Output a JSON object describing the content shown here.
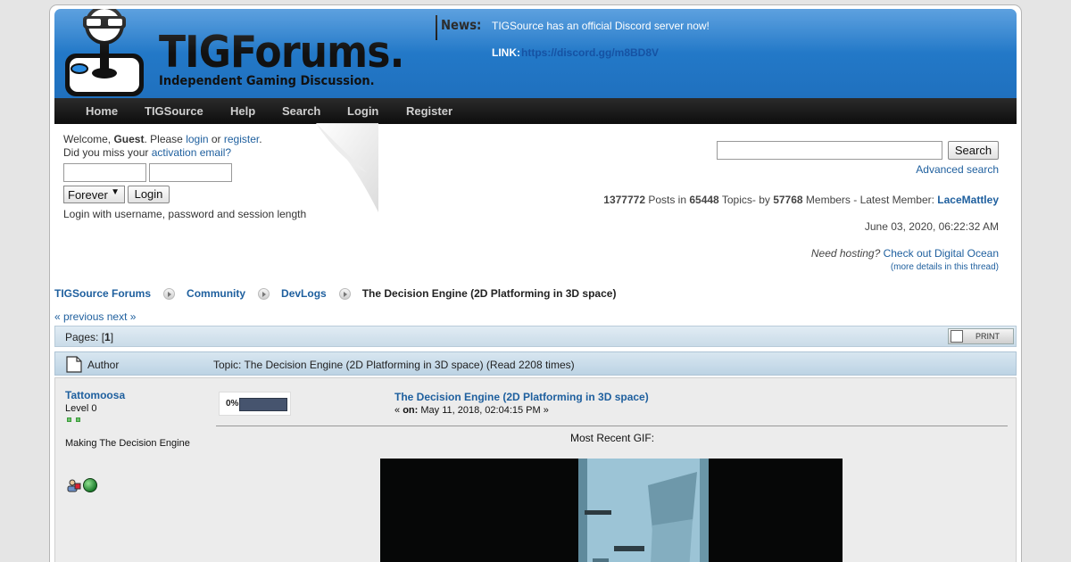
{
  "header": {
    "site_title": "TIGForums.",
    "site_subtitle": "Independent Gaming Discussion.",
    "news_label": "News:",
    "news_text": "TIGSource has an official Discord server now!",
    "news_link_label": "LINK:",
    "news_link": "https://discord.gg/m8BD8V",
    "banner_color": "#2379c8"
  },
  "nav": {
    "items": [
      {
        "label": "Home"
      },
      {
        "label": "TIGSource"
      },
      {
        "label": "Help"
      },
      {
        "label": "Search"
      },
      {
        "label": "Login"
      },
      {
        "label": "Register"
      }
    ]
  },
  "user_panel": {
    "welcome_prefix": "Welcome, ",
    "guest": "Guest",
    "please": ". Please ",
    "login_link": "login",
    "or": " or ",
    "register_link": "register",
    "period": ".",
    "missed_prefix": "Did you miss your ",
    "activation_link": "activation email?",
    "username_value": "",
    "password_value": "",
    "session_length": "Forever",
    "login_button": "Login",
    "login_note": "Login with username, password and session length"
  },
  "search": {
    "query": "",
    "button": "Search",
    "advanced": "Advanced search"
  },
  "stats": {
    "posts": "1377772",
    "posts_label": " Posts in ",
    "topics": "65448",
    "topics_label": " Topics- by ",
    "members": "57768",
    "members_label": " Members - Latest Member: ",
    "latest_member": "LaceMattley",
    "date": "June 03, 2020, 06:22:32 AM",
    "hosting_q": "Need hosting?",
    "hosting_link": "Check out Digital Ocean",
    "more_details": "(more details in this thread)"
  },
  "breadcrumb": {
    "items": [
      "TIGSource Forums",
      "Community",
      "DevLogs"
    ],
    "current": "The Decision Engine (2D Platforming in 3D space)"
  },
  "pagination": {
    "prev": "« previous",
    "next": "next »",
    "pages_label": "Pages: [",
    "current_page": "1",
    "pages_close": "]",
    "print": "PRINT"
  },
  "topic": {
    "author_header": "Author",
    "topic_header": "Topic: The Decision Engine (2D Platforming in 3D space)  (Read 2208 times)"
  },
  "post": {
    "poster_name": "Tattomoosa",
    "poster_level": "Level 0",
    "poster_stars": 2,
    "poster_tagline": "Making The Decision Engine",
    "progress_label": "0%",
    "progress_value": 0,
    "title": "The Decision Engine (2D Platforming in 3D space)",
    "meta_prefix": "« ",
    "meta_on": "on:",
    "meta_date": " May 11, 2018, 02:04:15 PM »",
    "body": "Most Recent GIF:"
  }
}
